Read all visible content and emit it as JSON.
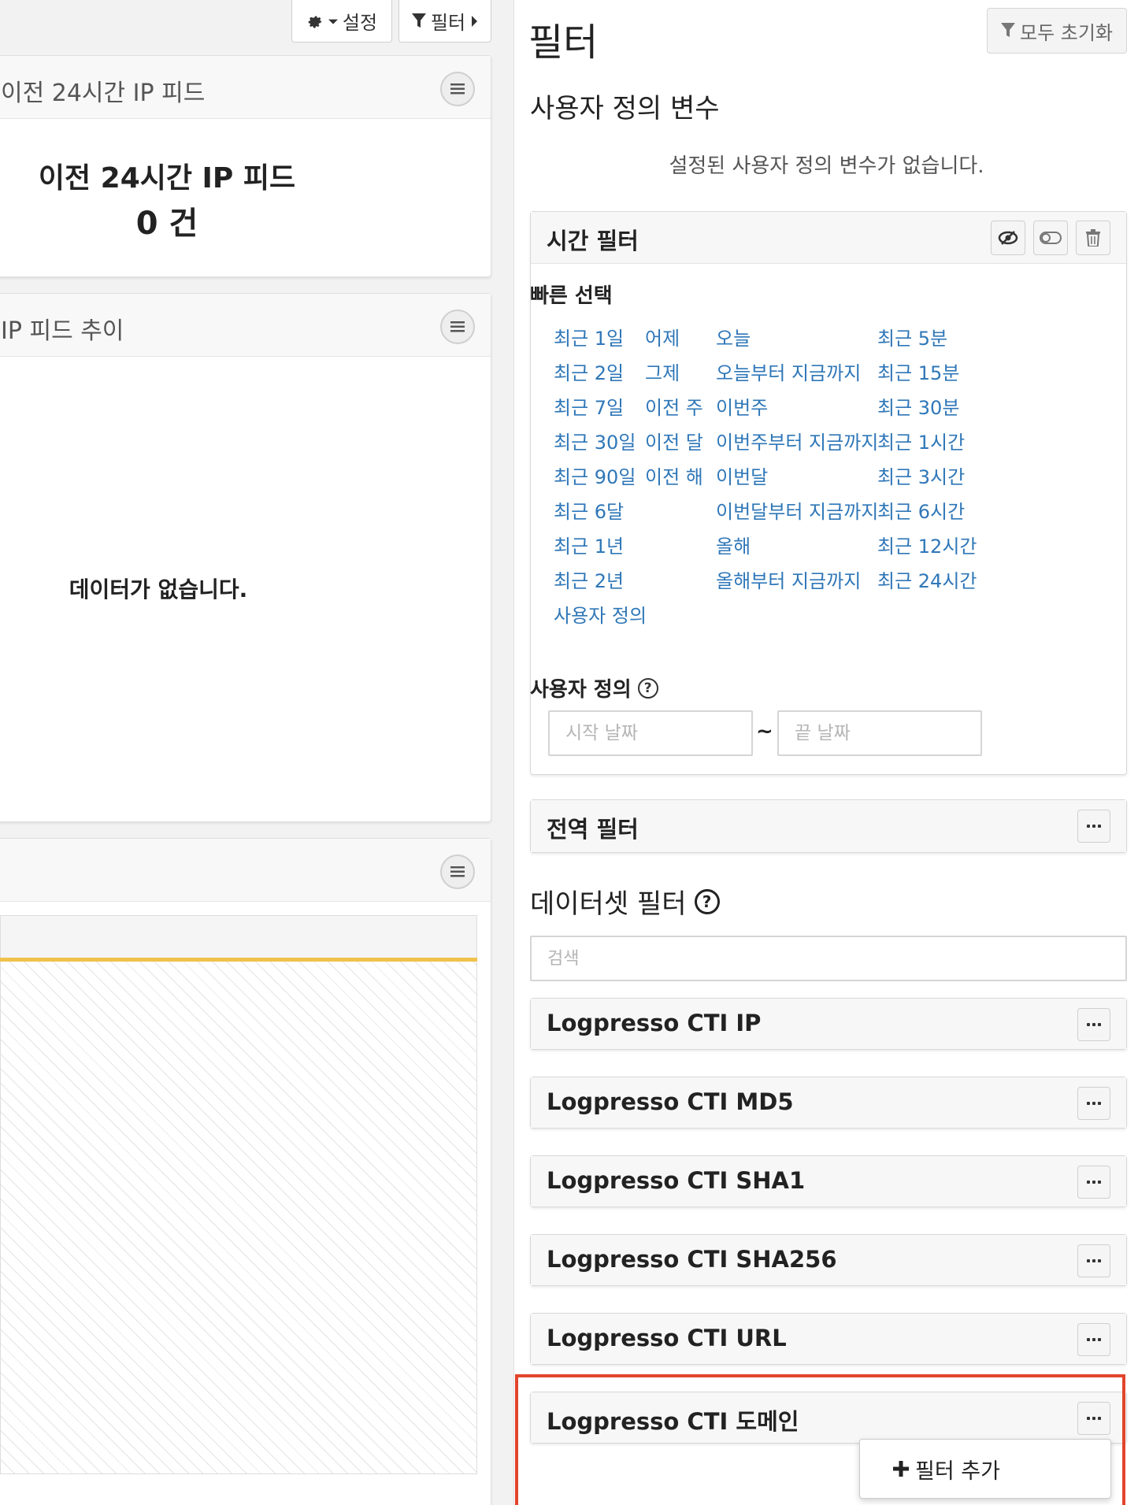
{
  "toolbar": {
    "settings_label": "설정",
    "filter_label": "필터"
  },
  "left": {
    "panel1": {
      "title": "이전 24시간 IP 피드",
      "big_title": "이전 24시간 IP 피드",
      "count_text": "0 건"
    },
    "panel2": {
      "title": "IP 피드 추이",
      "no_data": "데이터가 없습니다."
    }
  },
  "filter_panel": {
    "title": "필터",
    "reset_all_label": "모두 초기화",
    "user_vars_title": "사용자 정의 변수",
    "no_vars_text": "설정된 사용자 정의 변수가 없습니다.",
    "time_filter": {
      "title": "시간 필터",
      "quick_select_title": "빠른 선택",
      "col1": [
        "최근 1일",
        "최근 2일",
        "최근 7일",
        "최근 30일",
        "최근 90일",
        "최근 6달",
        "최근 1년",
        "최근 2년",
        "사용자 정의"
      ],
      "col2": [
        "어제",
        "그제",
        "이전 주",
        "이전 달",
        "이전 해"
      ],
      "col3": [
        "오늘",
        "오늘부터 지금까지",
        "이번주",
        "이번주부터 지금까지",
        "이번달",
        "이번달부터 지금까지",
        "올해",
        "올해부터 지금까지"
      ],
      "col4": [
        "최근 5분",
        "최근 15분",
        "최근 30분",
        "최근 1시간",
        "최근 3시간",
        "최근 6시간",
        "최근 12시간",
        "최근 24시간"
      ],
      "custom_title": "사용자 정의",
      "start_placeholder": "시작 날짜",
      "end_placeholder": "끝 날짜",
      "range_separator": "~"
    },
    "global_filter_title": "전역 필터",
    "dataset_filter_title": "데이터셋 필터",
    "search_placeholder": "검색",
    "datasets": [
      "Logpresso CTI IP",
      "Logpresso CTI MD5",
      "Logpresso CTI SHA1",
      "Logpresso CTI SHA256",
      "Logpresso CTI URL",
      "Logpresso CTI 도메인"
    ],
    "add_filter_label": "필터 추가"
  },
  "colors": {
    "link": "#2f77b8",
    "highlight": "#e2452c",
    "chart_line": "#f0c24a"
  }
}
